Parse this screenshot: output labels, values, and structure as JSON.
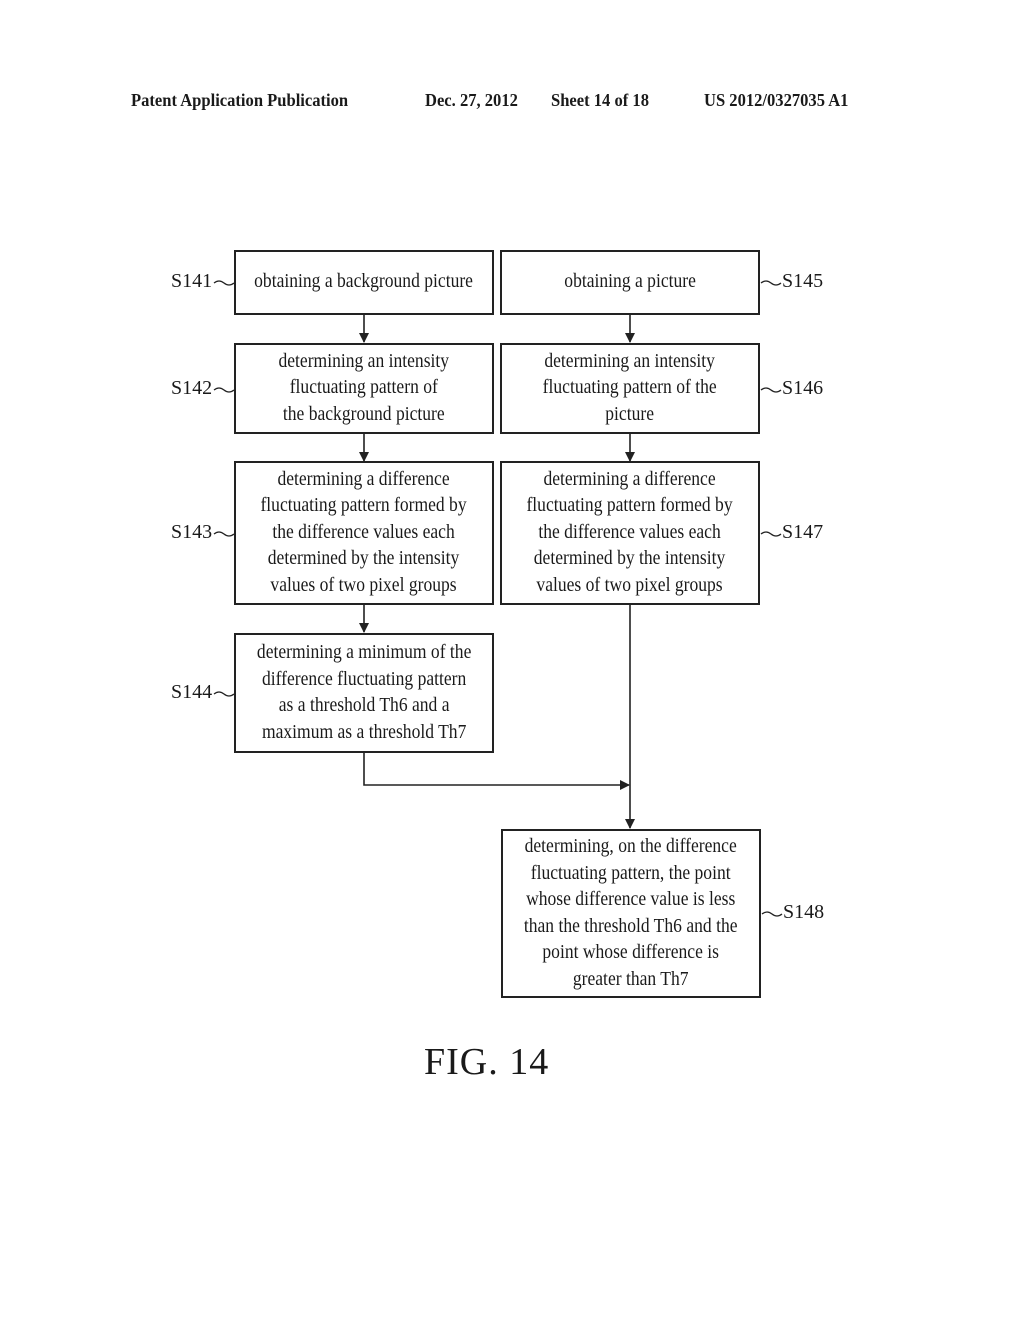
{
  "header": {
    "publication": "Patent Application Publication",
    "date": "Dec. 27, 2012",
    "sheet": "Sheet 14 of 18",
    "number": "US 2012/0327035 A1"
  },
  "steps": {
    "s141": {
      "label": "S141",
      "text": "obtaining a background picture"
    },
    "s142": {
      "label": "S142",
      "text": "determining an intensity\nfluctuating pattern of\nthe background picture"
    },
    "s143": {
      "label": "S143",
      "text": "determining a difference\nfluctuating pattern formed by\nthe difference values each\ndetermined by the intensity\nvalues of two pixel groups"
    },
    "s144": {
      "label": "S144",
      "text": "determining a minimum of the\ndifference fluctuating pattern\nas a threshold Th6 and a\nmaximum as a threshold Th7"
    },
    "s145": {
      "label": "S145",
      "text": "obtaining a picture"
    },
    "s146": {
      "label": "S146",
      "text": "determining an intensity\nfluctuating pattern of the\npicture"
    },
    "s147": {
      "label": "S147",
      "text": "determining a difference\nfluctuating pattern formed by\nthe difference values each\ndetermined by the intensity\nvalues of two pixel groups"
    },
    "s148": {
      "label": "S148",
      "text": "determining, on the difference\nfluctuating pattern, the point\nwhose difference value is less\nthan the threshold Th6 and the\npoint whose difference is\ngreater than Th7"
    }
  },
  "figure_caption": "FIG. 14"
}
